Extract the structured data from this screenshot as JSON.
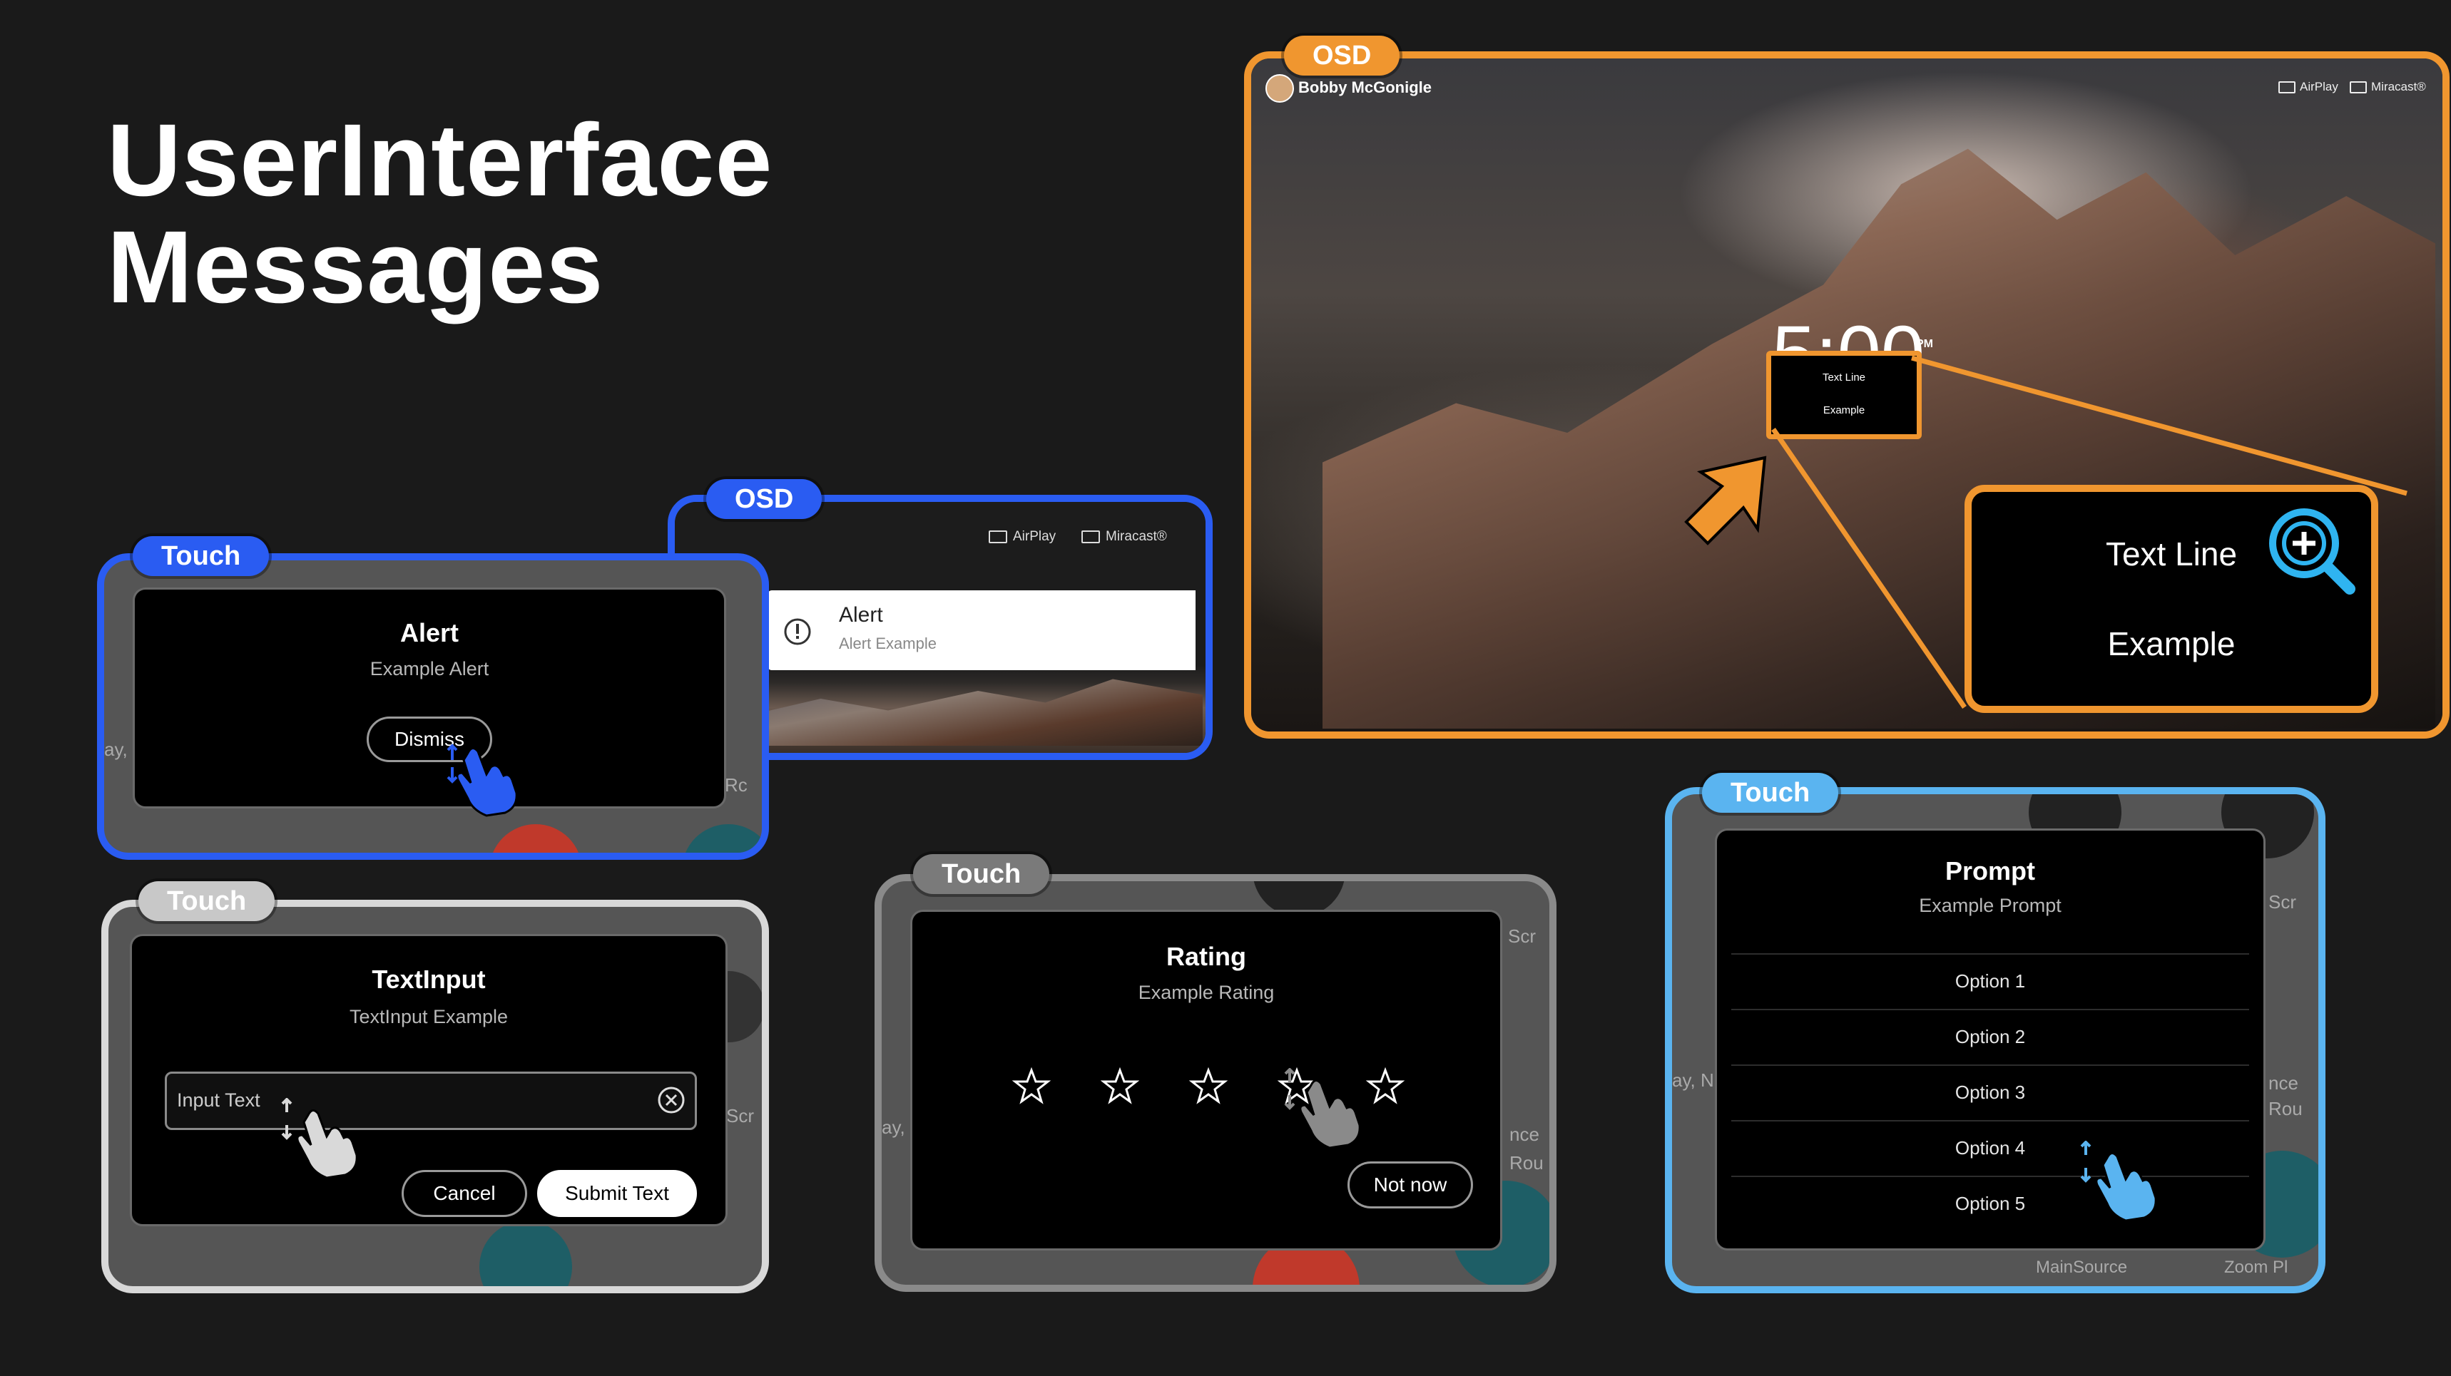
{
  "page": {
    "title_line1": "UserInterface",
    "title_line2": "Messages"
  },
  "tags": {
    "touch": "Touch",
    "osd": "OSD"
  },
  "colors": {
    "touch_blue": "#2a5cf2",
    "osd_orange": "#f0962f",
    "prompt_light_blue": "#5ab4f0",
    "gray_frame": "#8a8a8a",
    "white_frame": "#d8d8d8"
  },
  "alert_touch": {
    "title": "Alert",
    "subtitle": "Example Alert",
    "dismiss_label": "Dismiss",
    "hand_icon": "pointer-hand-icon"
  },
  "alert_osd": {
    "airplay_label": "AirPlay",
    "miracast_label": "Miracast®",
    "title": "Alert",
    "subtitle": "Alert Example",
    "icon": "exclamation-circle-icon"
  },
  "text_line_osd": {
    "user_name": "Bobby McGonigle",
    "airplay_label": "AirPlay",
    "miracast_label": "Miracast®",
    "clock_partial": "5:00",
    "clock_suffix": "PM",
    "small_line1": "Text Line",
    "small_line2": "Example",
    "zoom_line1": "Text Line",
    "zoom_line2": "Example",
    "zoom_icon": "zoom-in-icon"
  },
  "text_input_touch": {
    "title": "TextInput",
    "subtitle": "TextInput Example",
    "input_value": "Input Text",
    "cancel_label": "Cancel",
    "submit_label": "Submit Text",
    "clear_icon": "clear-x-icon"
  },
  "rating_touch": {
    "title": "Rating",
    "subtitle": "Example Rating",
    "stars": 5,
    "not_now_label": "Not now"
  },
  "prompt_touch": {
    "title": "Prompt",
    "subtitle": "Example Prompt",
    "options": [
      "Option 1",
      "Option 2",
      "Option 3",
      "Option 4",
      "Option 5"
    ],
    "bg_label_main_source": "MainSource",
    "bg_label_zoom": "Zoom Pl"
  },
  "bg_fragments": {
    "scr": "Scr",
    "nce": "nce",
    "rou": "Rou",
    "ay": "ay, N",
    "r": "Rc"
  }
}
